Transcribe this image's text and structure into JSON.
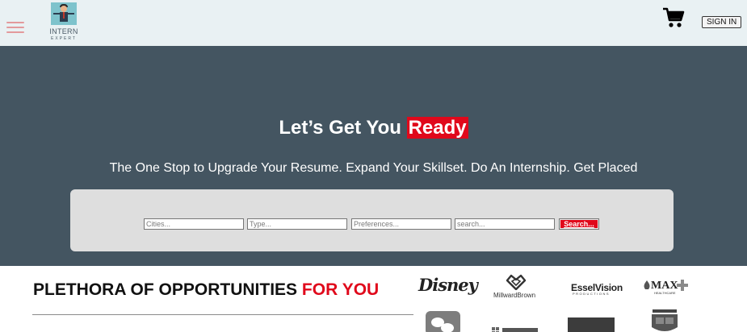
{
  "header": {
    "logo_line1": "INTERN",
    "logo_line2": "EXPERT",
    "signin_label": "SIGN IN",
    "icons": [
      "menu-icon",
      "cart-icon"
    ]
  },
  "hero": {
    "title_prefix": "Let’s Get You ",
    "title_highlight": "Ready",
    "subtitle": "The One Stop to Upgrade Your Resume. Expand Your Skillset. Do An Internship. Get Placed",
    "search": {
      "cities_placeholder": "Cities...",
      "type_placeholder": "Type...",
      "preferences_placeholder": "Preferences...",
      "query_placeholder": "search...",
      "button_label": "Search..."
    }
  },
  "opportunities": {
    "title_prefix": "PLETHORA OF OPPORTUNITIES ",
    "title_highlight": "FOR YOU"
  },
  "brands": {
    "disney": "Disney",
    "millward_brown": "MillwardBrown",
    "essel_vision": "EsselVision",
    "essel_sub": "PRODUCTIONS",
    "max": "MAX",
    "max_sub": "HEALTHCARE"
  },
  "colors": {
    "header_bg": "#e9f1f3",
    "hero_bg": "#445561",
    "accent_red": "#e0081b",
    "search_panel_bg": "#dedede"
  }
}
